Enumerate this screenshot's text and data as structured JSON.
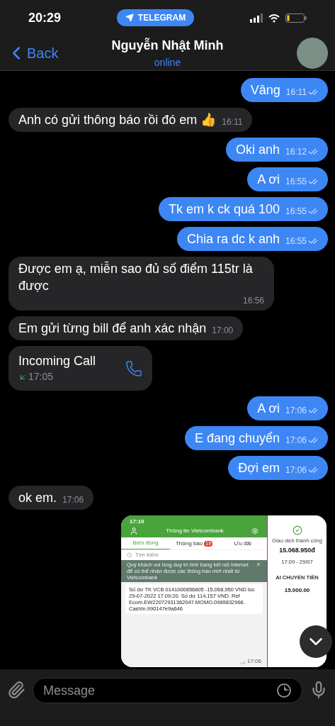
{
  "status_bar": {
    "time": "20:29",
    "app_pill": "TELEGRAM"
  },
  "header": {
    "back": "Back",
    "name": "Nguyễn Nhật Minh",
    "status": "online"
  },
  "messages": [
    {
      "kind": "out",
      "text": "Vâng",
      "time": "16:11",
      "read": true
    },
    {
      "kind": "in",
      "text": "Anh có gửi thông báo rồi đó em 👍",
      "time": "16:11"
    },
    {
      "kind": "out",
      "text": "Oki anh",
      "time": "16:12",
      "read": true
    },
    {
      "kind": "out",
      "text": "A ơi",
      "time": "16:55",
      "read": true
    },
    {
      "kind": "out",
      "text": "Tk em k ck quá 100",
      "time": "16:55",
      "read": true
    },
    {
      "kind": "out",
      "text": "Chia ra dc k anh",
      "time": "16:55",
      "read": true
    },
    {
      "kind": "in",
      "text": "Được em ạ, miễn sao đủ số điểm 115tr là được",
      "time": "16:56"
    },
    {
      "kind": "in",
      "text": "Em gửi từng bill để anh xác nhận",
      "time": "17:00"
    },
    {
      "kind": "call",
      "text": "Incoming Call",
      "time": "17:05"
    },
    {
      "kind": "out",
      "text": "A ơi",
      "time": "17:06",
      "read": true
    },
    {
      "kind": "out",
      "text": "E đang chuyển",
      "time": "17:06",
      "read": true
    },
    {
      "kind": "out",
      "text": "Đợi em",
      "time": "17:06",
      "read": true
    },
    {
      "kind": "in",
      "text": "ok em.",
      "time": "17:06"
    },
    {
      "kind": "photo",
      "time": "17:06",
      "read": true,
      "screenshot": {
        "time": "17:10",
        "title": "Thông tin Vietcombank",
        "tabs": [
          {
            "label": "Biến động",
            "selected": true
          },
          {
            "label": "Thông báo",
            "selected": false,
            "badge": "19"
          },
          {
            "label": "Ưu đãi",
            "selected": false
          }
        ],
        "search_placeholder": "Tìm kiếm",
        "banner": "Quý khách vui lòng duy trì tình trạng kết nối internet để có thể nhận được các thông báo mới nhất từ Vietcombank",
        "notice": "Số dư TK VCB 0141000856805 -15,068,950 VND lúc 29-07-2022 17:09:20. Số dư 114,157 VND. Ref Ecom.EW22072931362047.MOMO.0989832966. CashIn.990147e9a646",
        "receipt": {
          "status": "Giao dịch thành công",
          "amount": "15.068.950đ",
          "datetime": "17:09 - 29/07",
          "section": "AI CHUYỂN TIỀN",
          "sub_amount": "15.000.00"
        }
      }
    }
  ],
  "composer": {
    "placeholder": "Message"
  }
}
